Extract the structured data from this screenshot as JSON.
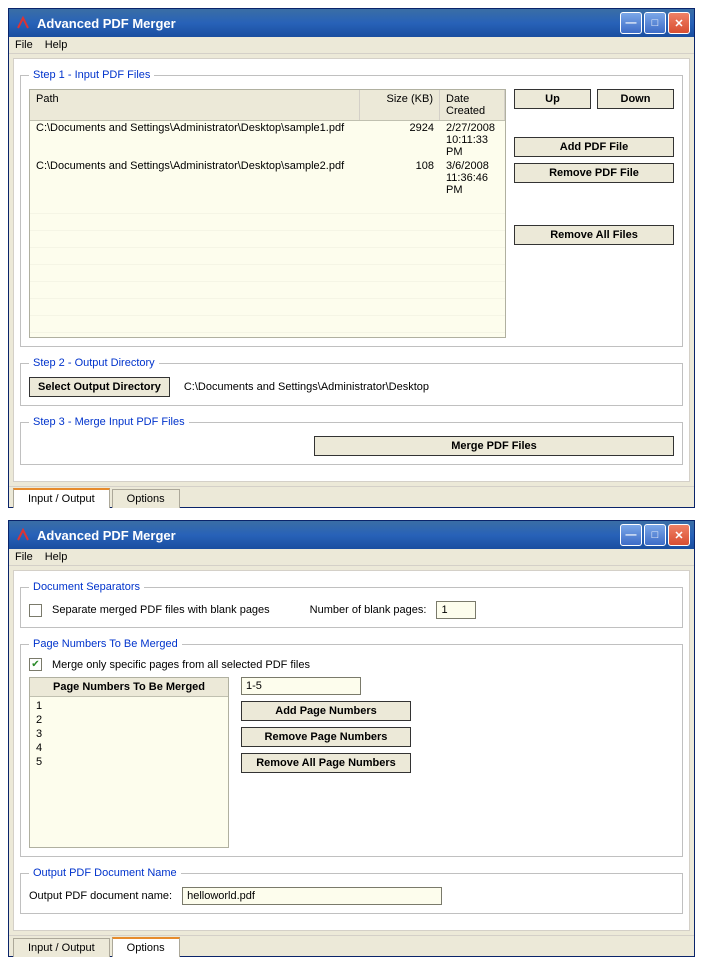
{
  "app": {
    "title": "Advanced PDF Merger",
    "menu": {
      "file": "File",
      "help": "Help"
    }
  },
  "window1": {
    "step1": {
      "legend": "Step 1 - Input PDF Files",
      "headers": {
        "path": "Path",
        "size": "Size (KB)",
        "date": "Date Created"
      },
      "rows": [
        {
          "path": "C:\\Documents and Settings\\Administrator\\Desktop\\sample1.pdf",
          "size": "2924",
          "date": "2/27/2008 10:11:33 PM"
        },
        {
          "path": "C:\\Documents and Settings\\Administrator\\Desktop\\sample2.pdf",
          "size": "108",
          "date": "3/6/2008 11:36:46 PM"
        }
      ],
      "buttons": {
        "up": "Up",
        "down": "Down",
        "add": "Add PDF File",
        "remove": "Remove PDF File",
        "removeAll": "Remove All Files"
      }
    },
    "step2": {
      "legend": "Step 2 - Output Directory",
      "button": "Select Output Directory",
      "path": "C:\\Documents and Settings\\Administrator\\Desktop"
    },
    "step3": {
      "legend": "Step 3 - Merge Input PDF Files",
      "button": "Merge PDF Files"
    },
    "tabs": {
      "io": "Input / Output",
      "options": "Options"
    }
  },
  "window2": {
    "separators": {
      "legend": "Document Separators",
      "checkLabel": "Separate merged PDF files with blank pages",
      "numLabel": "Number of blank pages:",
      "numValue": "1"
    },
    "pageNumbers": {
      "legend": "Page Numbers To Be Merged",
      "checkLabel": "Merge only specific pages from all selected PDF files",
      "listHeader": "Page Numbers To Be Merged",
      "items": [
        "1",
        "2",
        "3",
        "4",
        "5"
      ],
      "inputValue": "1-5",
      "buttons": {
        "add": "Add Page Numbers",
        "remove": "Remove Page Numbers",
        "removeAll": "Remove All Page Numbers"
      }
    },
    "output": {
      "legend": "Output PDF Document Name",
      "label": "Output PDF document name:",
      "value": "helloworld.pdf"
    },
    "tabs": {
      "io": "Input / Output",
      "options": "Options"
    }
  }
}
